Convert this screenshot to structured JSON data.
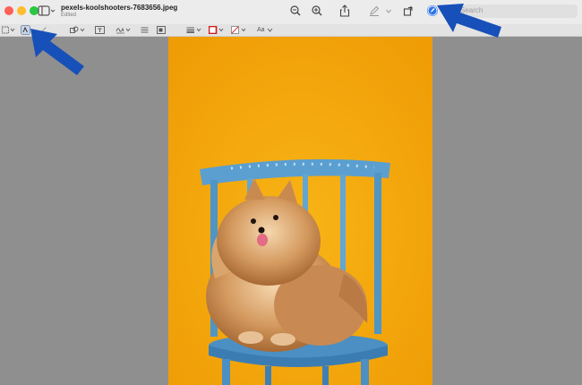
{
  "window": {
    "title": "pexels-koolshooters-7683656.jpeg",
    "subtitle": "Edited"
  },
  "toolbar": {
    "search_placeholder": "Search"
  },
  "markup_toolbar": {
    "text_style_label": "Aa"
  },
  "icons": {
    "sidebar": "sidebar-icon",
    "zoom_out": "zoom-out-icon",
    "zoom_in": "zoom-in-icon",
    "share": "share-icon",
    "highlight": "pen-icon",
    "rotate": "rotate-icon",
    "markup": "markup-icon",
    "search": "search-icon"
  },
  "colors": {
    "photo_background": "#f4a40a",
    "chair": "#5a9fcf",
    "annotation_arrow": "#1750b8",
    "close": "#fe5f57",
    "minimize": "#febc2e",
    "zoom": "#28c840"
  }
}
